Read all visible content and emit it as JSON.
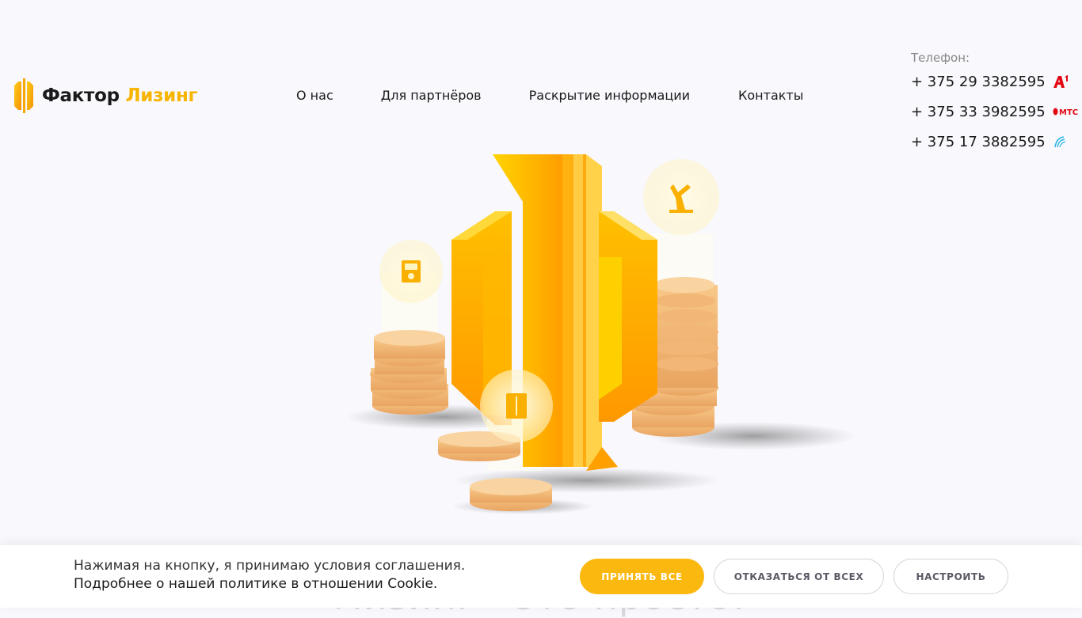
{
  "brand": {
    "word1": "Фактор",
    "word2": "Лизинг",
    "accent_color": "#f7b500"
  },
  "nav": {
    "items": [
      {
        "label": "О нас"
      },
      {
        "label": "Для партнёров"
      },
      {
        "label": "Раскрытие информации"
      },
      {
        "label": "Контакты"
      }
    ]
  },
  "contacts": {
    "label": "Телефон:",
    "phones": [
      {
        "number": "+ 375 29 3382595",
        "operator": "A1",
        "operator_icon": "a1-operator-icon"
      },
      {
        "number": "+ 375 33 3982595",
        "operator": "МТС",
        "operator_icon": "mts-operator-icon"
      },
      {
        "number": "+ 375 17 3882595",
        "operator": "landline",
        "operator_icon": "beltelecom-operator-icon"
      }
    ]
  },
  "hero": {
    "title": "Лизинг - это просто!",
    "illustration": "coins-and-logo-illustration"
  },
  "cookie": {
    "line1": "Нажимая на кнопку, я принимаю условия соглашения.",
    "line2": "Подробнее о нашей политике в отношении Cookie.",
    "accept_label": "Принять все",
    "reject_label": "Отказаться от всех",
    "settings_label": "Настроить",
    "accept_color": "#fbb80f"
  }
}
